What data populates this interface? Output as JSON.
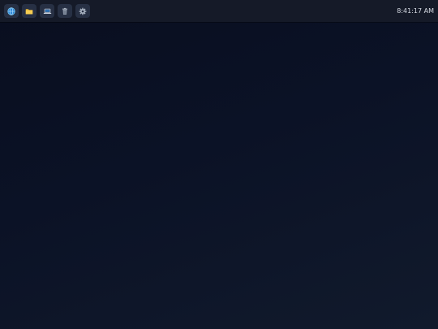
{
  "taskbar": {
    "launchers": [
      {
        "icon": "globe-icon",
        "app": "browser"
      },
      {
        "icon": "folder-icon",
        "app": "files"
      },
      {
        "icon": "laptop-icon",
        "app": "terminal"
      },
      {
        "icon": "trash-icon",
        "app": "trash"
      },
      {
        "icon": "gear-icon",
        "app": "settings"
      }
    ],
    "clock": "8:41:17 AM"
  },
  "colors": {
    "taskbar_bg": "#151a28",
    "launcher_bg": "#273044",
    "desktop_bg_start": "#090e1f",
    "desktop_bg_end": "#111a2c",
    "clock_text": "#d7dbe4"
  }
}
